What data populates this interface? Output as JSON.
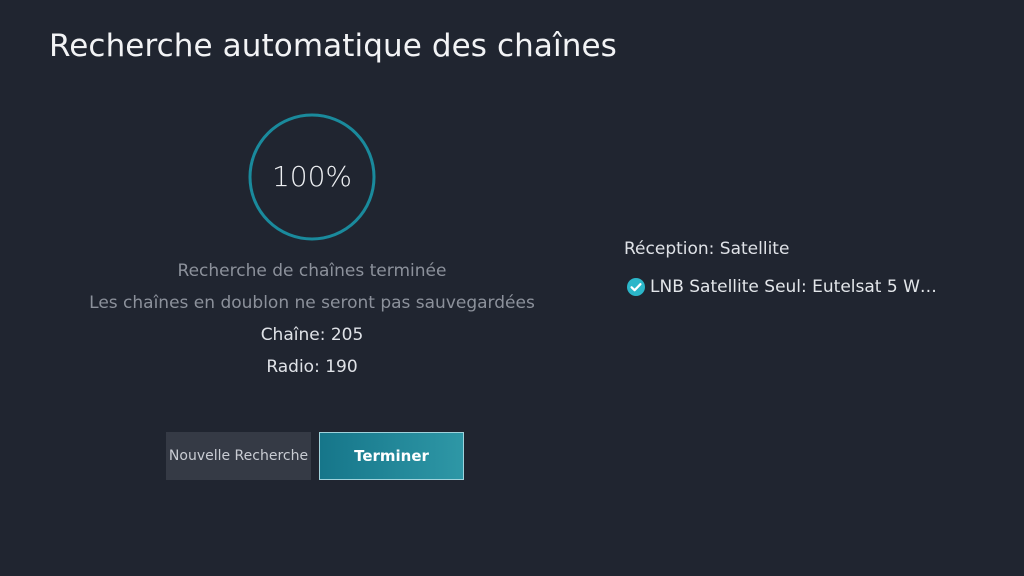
{
  "header": {
    "title": "Recherche automatique des chaînes"
  },
  "progress": {
    "value": 100,
    "label": "100%",
    "ring_color": "#1a8a9c"
  },
  "status": {
    "completed": "Recherche de chaînes terminée",
    "duplicates_note": "Les chaînes en doublon ne seront pas sauvegardées",
    "tv_count": "Chaîne: 205",
    "radio_count": "Radio: 190"
  },
  "buttons": {
    "new_search": "Nouvelle Recherche",
    "finish": "Terminer"
  },
  "reception": {
    "label": "Réception: Satellite",
    "lnb": "LNB Satellite Seul: Eutelsat 5 W…",
    "lnb_icon": "check-circle-icon",
    "accent_color": "#2bb6c9"
  }
}
